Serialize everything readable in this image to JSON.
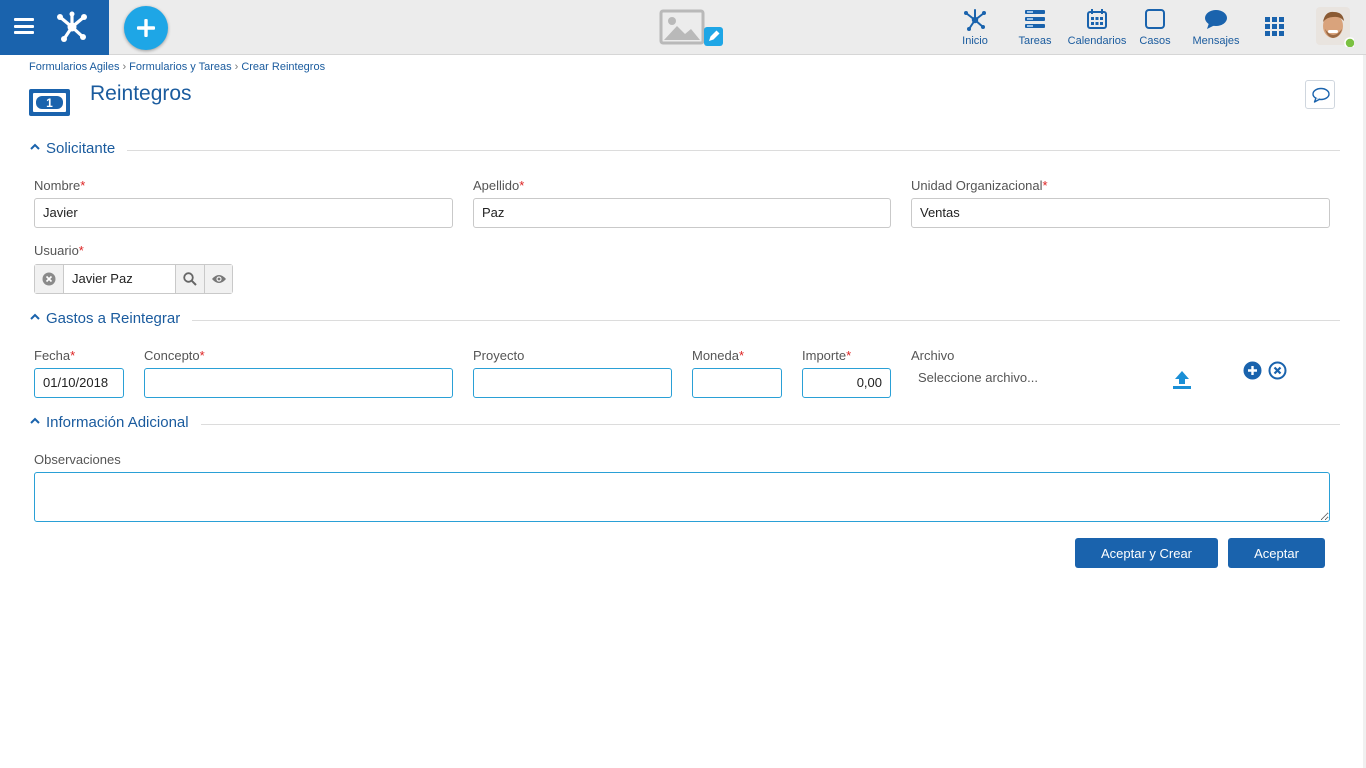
{
  "colors": {
    "primary": "#1a63ad",
    "accent": "#1ea6e6",
    "required": "#d22222",
    "status_online": "#7bc142"
  },
  "topbar": {
    "menu_icon": "hamburger-icon",
    "logo_icon": "network-logo-icon",
    "new_icon": "plus-icon",
    "image_placeholder_icon": "image-placeholder-icon",
    "nav": [
      {
        "label": "Inicio",
        "icon": "home-network-icon"
      },
      {
        "label": "Tareas",
        "icon": "tasks-icon"
      },
      {
        "label": "Calendarios",
        "icon": "calendar-icon"
      },
      {
        "label": "Casos",
        "icon": "cases-icon"
      },
      {
        "label": "Mensajes",
        "icon": "messages-icon"
      }
    ],
    "apps_icon": "apps-grid-icon"
  },
  "breadcrumb": [
    "Formularios Agiles",
    "Formularios y Tareas",
    "Crear Reintegros"
  ],
  "page": {
    "title": "Reintegros",
    "icon": "money-bill-icon"
  },
  "sections": {
    "solicitante": "Solicitante",
    "gastos": "Gastos a Reintegrar",
    "info": "Información Adicional"
  },
  "solicitante": {
    "nombre_label": "Nombre",
    "nombre_value": "Javier",
    "apellido_label": "Apellido",
    "apellido_value": "Paz",
    "unidad_label": "Unidad Organizacional",
    "unidad_value": "Ventas",
    "usuario_label": "Usuario",
    "usuario_value": "Javier Paz"
  },
  "gastos": {
    "fecha_label": "Fecha",
    "fecha_value": "01/10/2018",
    "concepto_label": "Concepto",
    "concepto_value": "",
    "proyecto_label": "Proyecto",
    "proyecto_value": "",
    "moneda_label": "Moneda",
    "moneda_value": "",
    "importe_label": "Importe",
    "importe_value": "0,00",
    "archivo_label": "Archivo",
    "archivo_placeholder": "Seleccione archivo..."
  },
  "info": {
    "observaciones_label": "Observaciones",
    "observaciones_value": ""
  },
  "actions": {
    "accept_create": "Aceptar y Crear",
    "accept": "Aceptar"
  },
  "required_mark": "*"
}
